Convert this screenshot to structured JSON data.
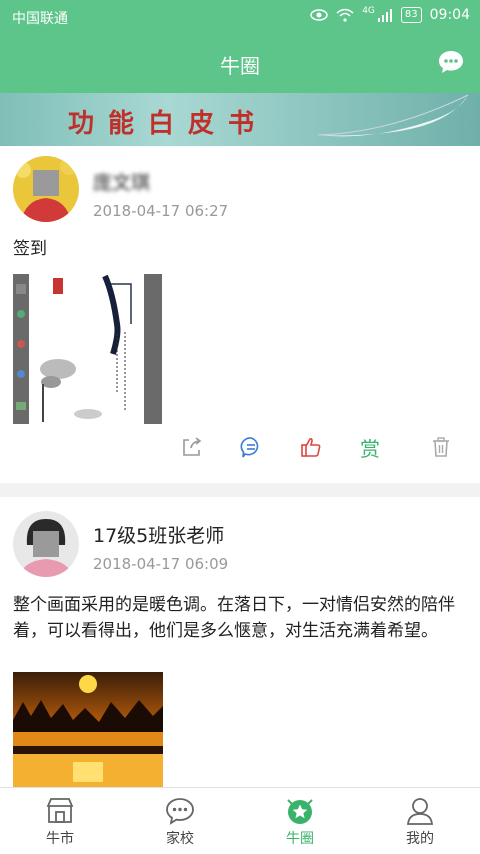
{
  "status_bar": {
    "carrier": "中国联通",
    "network": "4G",
    "battery": "83",
    "time": "09:04"
  },
  "header": {
    "title": "牛圈"
  },
  "banner": {
    "text": "功能白皮书"
  },
  "posts": [
    {
      "name": "庞文琪",
      "time": "2018-04-17 06:27",
      "content": "签到"
    },
    {
      "name": "17级5班张老师",
      "time": "2018-04-17 06:09",
      "content": "整个画面采用的是暖色调。在落日下，一对情侣安然的陪伴着，可以看得出，他们是多么惬意，对生活充满着希望。"
    }
  ],
  "actions": {
    "reward_label": "赏"
  },
  "tabs": [
    {
      "label": "牛市"
    },
    {
      "label": "家校"
    },
    {
      "label": "牛圈"
    },
    {
      "label": "我的"
    }
  ],
  "colors": {
    "primary": "#5dc48a",
    "active_tab": "#3ab26c",
    "like": "#e0443f",
    "comment": "#3a7bd5"
  }
}
